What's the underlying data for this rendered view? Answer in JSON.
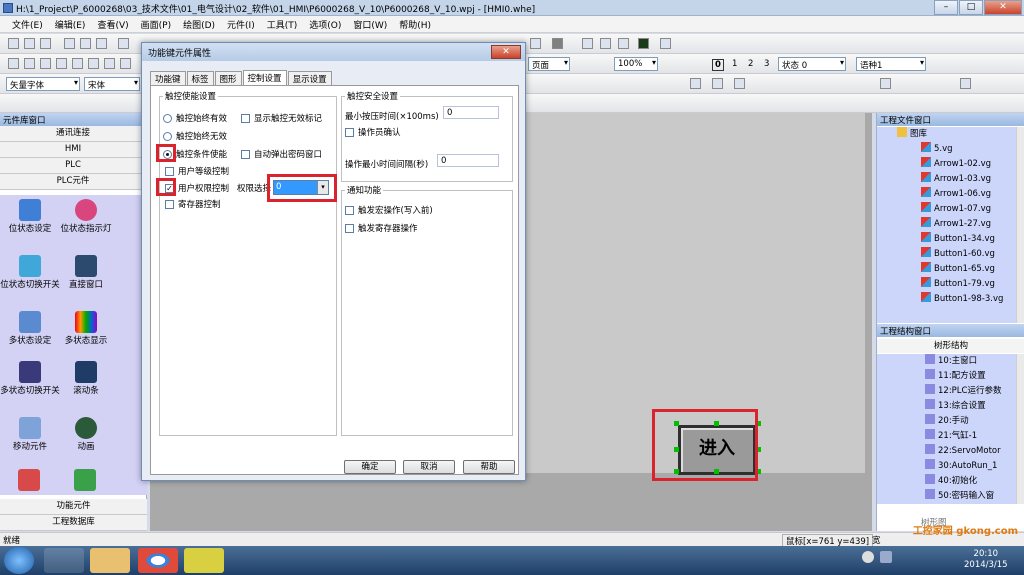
{
  "window": {
    "title": "H:\\1_Project\\P_6000268\\03_技术文件\\01_电气设计\\02_软件\\01_HMI\\P6000268_V_10\\P6000268_V_10.wpj - [HMI0.whe]",
    "min": "–",
    "max": "□",
    "close": "✕"
  },
  "menu": [
    "文件(E)",
    "编辑(E)",
    "查看(V)",
    "画面(P)",
    "绘图(D)",
    "元件(I)",
    "工具(T)",
    "选项(O)",
    "窗口(W)",
    "帮助(H)"
  ],
  "toolbar": {
    "font_combo": "矢量字体",
    "font_name": "宋体",
    "page_combo": "页面",
    "zoom": "100%",
    "states": [
      "0",
      "1",
      "2",
      "3"
    ],
    "state_label": "状态 0",
    "lang_label": "语种1"
  },
  "left_panel": {
    "title": "元件库窗口",
    "categories": [
      "通讯连接",
      "HMI",
      "PLC",
      "PLC元件"
    ],
    "items": [
      {
        "label": "位状态设定",
        "icon": "bit-set-icon"
      },
      {
        "label": "位状态指示灯",
        "icon": "bit-lamp-icon"
      },
      {
        "label": "位状态切换开关",
        "icon": "bit-switch-icon"
      },
      {
        "label": "直接窗口",
        "icon": "direct-window-icon"
      },
      {
        "label": "多状态设定",
        "icon": "multi-set-icon"
      },
      {
        "label": "多状态显示",
        "icon": "multi-display-icon"
      },
      {
        "label": "多状态切换开关",
        "icon": "multi-switch-icon"
      },
      {
        "label": "滚动条",
        "icon": "scrollbar-icon"
      },
      {
        "label": "移动元件",
        "icon": "move-element-icon"
      },
      {
        "label": "动画",
        "icon": "animation-icon"
      }
    ],
    "footer": [
      "功能元件",
      "工程数据库"
    ]
  },
  "canvas": {
    "enter_button": "进入"
  },
  "right_panel": {
    "file_title": "工程文件窗口",
    "folder": "图库",
    "files": [
      "5.vg",
      "Arrow1-02.vg",
      "Arrow1-03.vg",
      "Arrow1-06.vg",
      "Arrow1-07.vg",
      "Arrow1-27.vg",
      "Button1-34.vg",
      "Button1-60.vg",
      "Button1-65.vg",
      "Button1-79.vg",
      "Button1-98-3.vg"
    ],
    "struct_title": "工程结构窗口",
    "tree_title": "树形结构",
    "nodes": [
      "10:主窗口",
      "11:配方设置",
      "12:PLC运行参数",
      "13:综合设置",
      "20:手动",
      "21:气缸-1",
      "22:ServoMotor",
      "30:AutoRun_1",
      "40:初始化",
      "50:密码输入窗"
    ],
    "bottom_label": "树形图"
  },
  "dialog": {
    "title": "功能键元件属性",
    "close": "✕",
    "tabs": [
      "功能键",
      "标签",
      "图形",
      "控制设置",
      "显示设置"
    ],
    "active_tab": 3,
    "touch_group": "触控使能设置",
    "opt_always_on": "触控始终有效",
    "opt_show_invalid": "显示触控无效标记",
    "opt_always_off": "触控始终无效",
    "opt_condition": "触控条件使能",
    "opt_auto_pwd": "自动弹出密码窗口",
    "opt_user_level": "用户等级控制",
    "opt_user_perm": "用户权限控制",
    "perm_label": "权限选择",
    "perm_value": "0",
    "opt_register": "寄存器控制",
    "safety_group": "触控安全设置",
    "min_press_label": "最小按压时间(×100ms)",
    "min_press_value": "0",
    "opt_confirm": "操作员确认",
    "min_interval_label": "操作最小时间间隔(秒)",
    "min_interval_value": "0",
    "notify_group": "通知功能",
    "opt_macro": "触发宏操作(写入前)",
    "opt_reg_op": "触发寄存器操作",
    "ok": "确定",
    "cancel": "取消",
    "help": "帮助"
  },
  "statusbar": {
    "ready": "就绪",
    "cursor": "鼠标[x=761  y=439]",
    "extra": "宽"
  },
  "taskbar": {
    "time": "20:10",
    "date": "2014/3/15"
  },
  "watermark": "工控家园 gkong.com"
}
